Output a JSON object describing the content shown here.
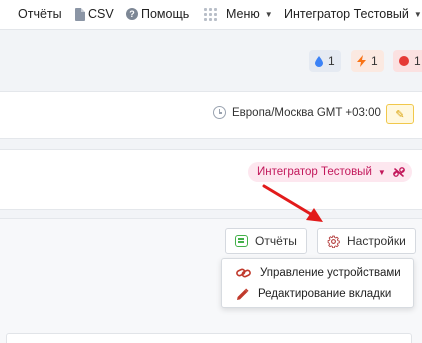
{
  "nav": {
    "reports": "Отчёты",
    "csv": "CSV",
    "help": "Помощь",
    "menu": "Меню",
    "user": "Интегратор Тестовый"
  },
  "badges": [
    {
      "icon": "drop-icon",
      "count": "1",
      "color": "#3b82f6"
    },
    {
      "icon": "lightning-icon",
      "count": "1",
      "color": "#f97316"
    },
    {
      "icon": "alert-dot-icon",
      "count": "1",
      "color": "#e53935"
    }
  ],
  "timezone": {
    "text": "Европа/Москва GMT +03:00"
  },
  "integrator": {
    "label": "Интегратор Тестовый"
  },
  "toolbar": {
    "reports_label": "Отчёты",
    "settings_label": "Настройки"
  },
  "settings_menu": {
    "items": [
      {
        "label": "Управление устройствами",
        "icon": "link-icon"
      },
      {
        "label": "Редактирование вкладки",
        "icon": "pencil-icon"
      }
    ]
  },
  "annotation": {
    "arrow_color": "#e21b1b"
  }
}
